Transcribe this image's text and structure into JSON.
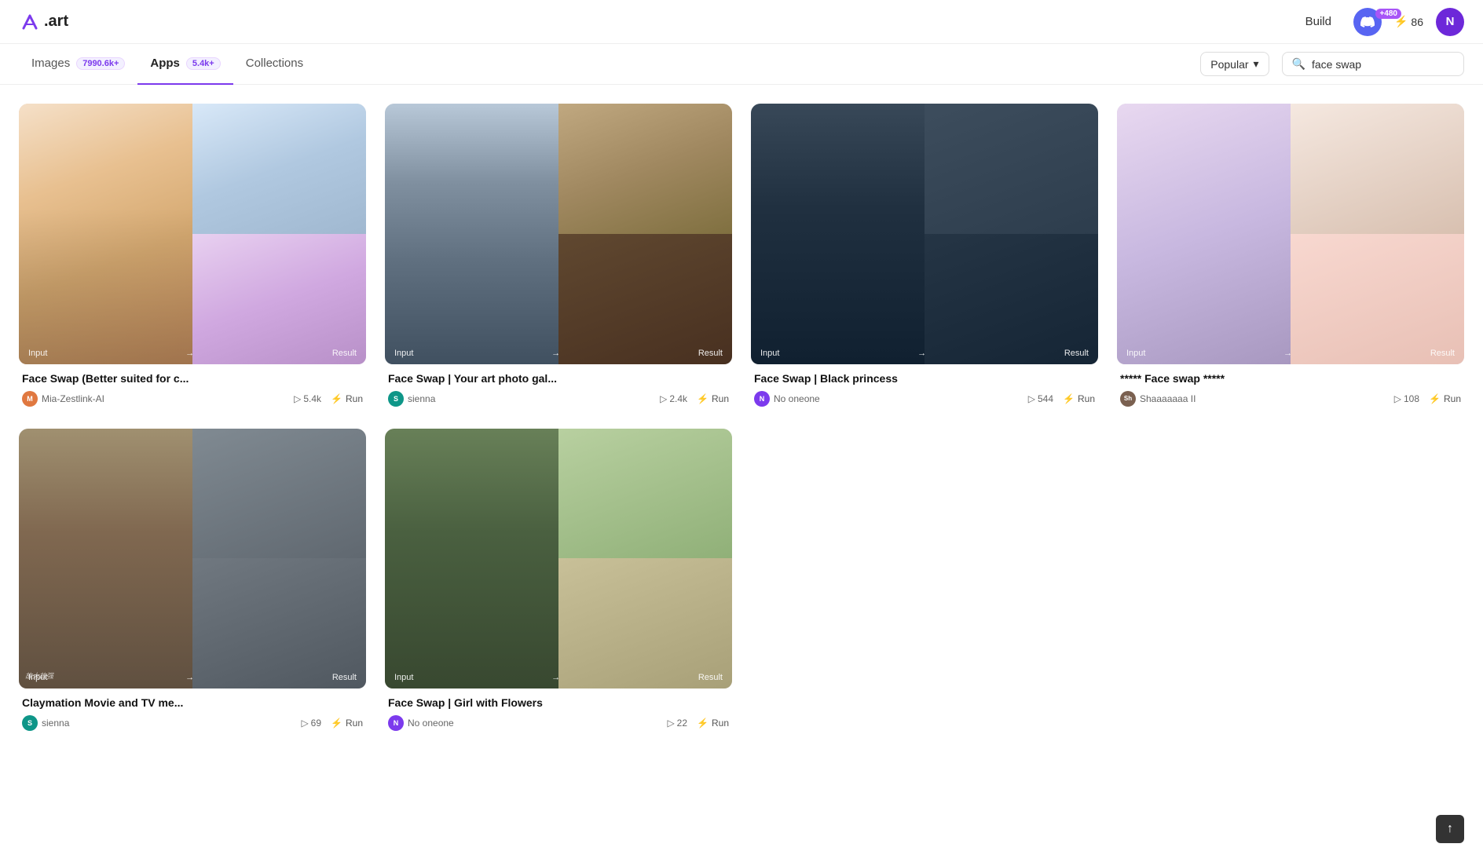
{
  "header": {
    "logo_text": ".art",
    "build_label": "Build",
    "notification_badge": "+480",
    "bolt_count": "86",
    "avatar_letter": "N"
  },
  "nav": {
    "tabs": [
      {
        "id": "images",
        "label": "Images",
        "badge": "7990.6k+",
        "active": false
      },
      {
        "id": "apps",
        "label": "Apps",
        "badge": "5.4k+",
        "active": true
      },
      {
        "id": "collections",
        "label": "Collections",
        "badge": null,
        "active": false
      }
    ],
    "filter_label": "Popular",
    "search_placeholder": "face swap",
    "search_value": "face swap"
  },
  "cards": [
    {
      "id": "card-1",
      "title": "Face Swap  (Better suited for c...",
      "author": "Mia-Zestlink-AI",
      "author_color": "orange",
      "views": "5.4k",
      "run_label": "Run",
      "input_label": "Input",
      "result_label": "Result",
      "color_scheme": "female-portrait"
    },
    {
      "id": "card-2",
      "title": "Face Swap | Your art photo gal...",
      "author": "sienna",
      "author_color": "teal",
      "views": "2.4k",
      "run_label": "Run",
      "input_label": "Input",
      "result_label": "Result",
      "color_scheme": "beast-warrior"
    },
    {
      "id": "card-3",
      "title": "Face Swap | Black princess",
      "author": "No oneone",
      "author_color": "purple",
      "views": "544",
      "run_label": "Run",
      "input_label": "Input",
      "result_label": "Result",
      "color_scheme": "dark-princess"
    },
    {
      "id": "card-4",
      "title": "***** Face swap *****",
      "author": "Shaaaaaaa II",
      "author_color": "brown",
      "views": "108",
      "run_label": "Run",
      "input_label": "Input",
      "result_label": "Result",
      "color_scheme": "female-light"
    },
    {
      "id": "card-5",
      "title": "Claymation Movie and TV me...",
      "author": "sienna",
      "author_color": "teal",
      "views": "69",
      "run_label": "Run",
      "input_label": "Input",
      "result_label": "Result",
      "color_scheme": "claymation"
    },
    {
      "id": "card-6",
      "title": "Face Swap | Girl with Flowers",
      "author": "No oneone",
      "author_color": "purple",
      "views": "22",
      "run_label": "Run",
      "input_label": "Input",
      "result_label": "Result",
      "color_scheme": "flowers"
    }
  ],
  "icons": {
    "search": "🔍",
    "chevron_down": "▾",
    "play": "▷",
    "wand": "⚡",
    "bolt": "⚡",
    "arrow_right": "→",
    "arrow_up": "↑",
    "discord": "discord"
  }
}
